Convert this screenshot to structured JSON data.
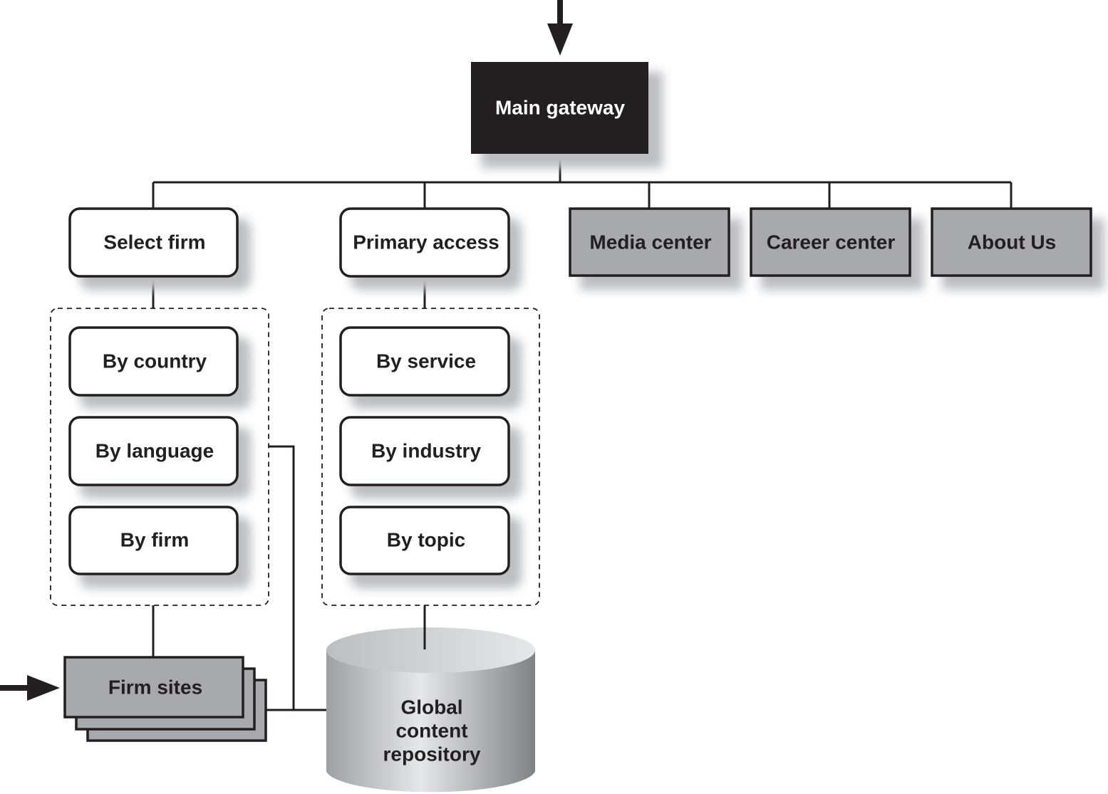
{
  "nodes": {
    "main_gateway": "Main gateway",
    "select_firm": "Select firm",
    "primary_access": "Primary access",
    "media_center": "Media center",
    "career_center": "Career center",
    "about_us": "About Us",
    "by_country": "By country",
    "by_language": "By language",
    "by_firm": "By firm",
    "by_service": "By service",
    "by_industry": "By industry",
    "by_topic": "By topic",
    "firm_sites": "Firm sites",
    "repository": [
      "Global",
      "content",
      "repository"
    ]
  },
  "colors": {
    "main_fill": "#231f20",
    "gray_fill": "#a7a9ac",
    "white_fill": "#ffffff"
  }
}
